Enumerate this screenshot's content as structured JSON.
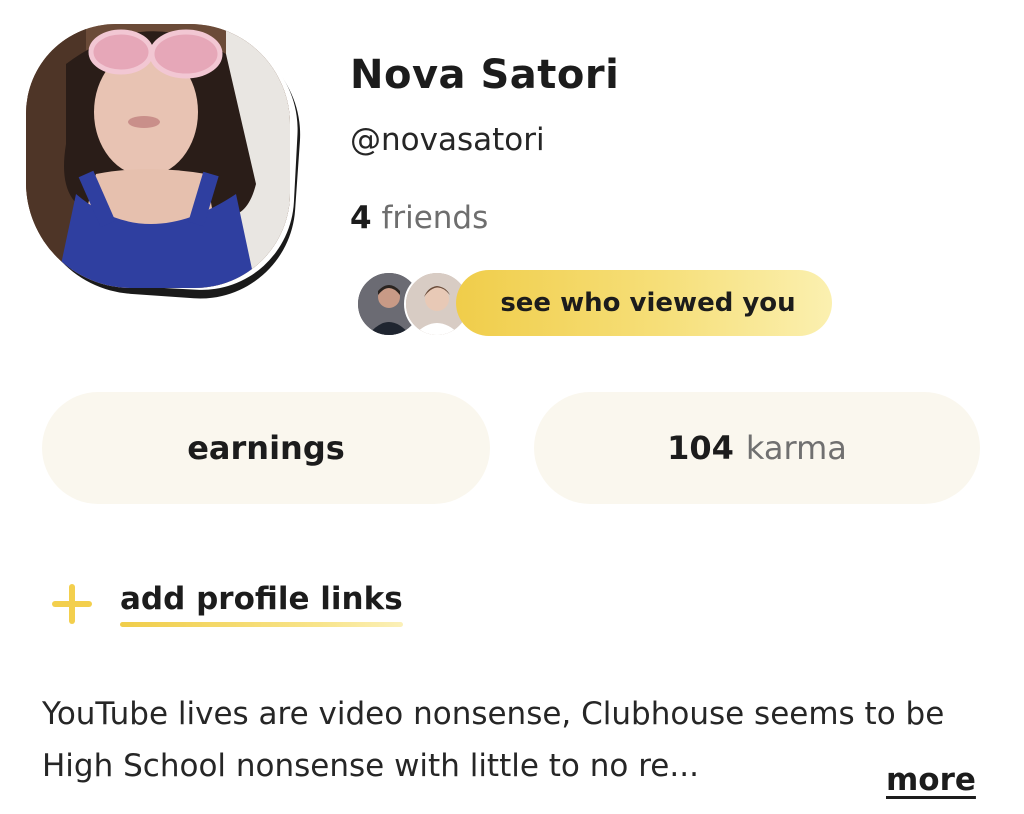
{
  "profile": {
    "name": "Nova Satori",
    "handle": "@novasatori",
    "friends_count": "4",
    "friends_label": "friends",
    "avatar_icon": "profile-photo"
  },
  "viewers": {
    "button_label": "see who viewed you",
    "avatars": [
      "viewer-avatar-1",
      "viewer-avatar-2"
    ]
  },
  "stats": {
    "earnings_label": "earnings",
    "karma_value": "104",
    "karma_label": "karma"
  },
  "links": {
    "add_label": "add profile links"
  },
  "bio": {
    "text": "YouTube lives are video nonsense, Clubhouse seems to be High School nonsense with little to no re...",
    "more_label": "more"
  },
  "colors": {
    "accent_yellow": "#f3cf4d",
    "pill_bg": "#faf7ee",
    "text_dark": "#1c1c1c",
    "text_muted": "#707070"
  }
}
